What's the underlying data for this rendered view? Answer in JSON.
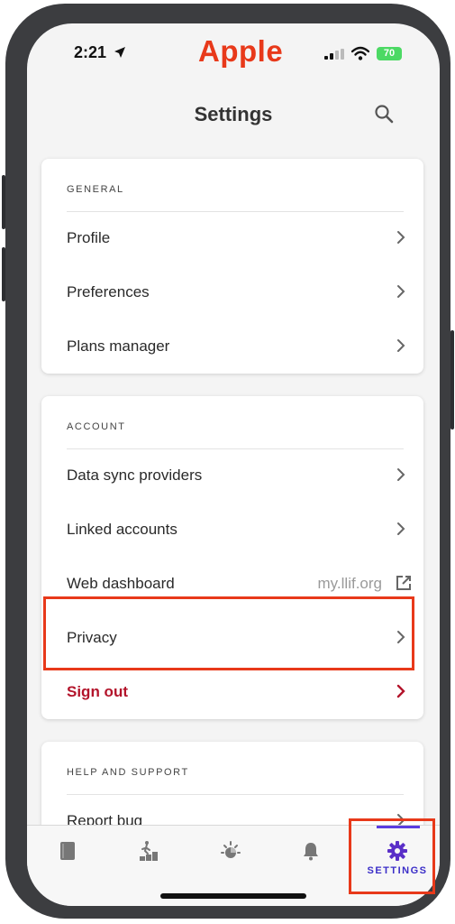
{
  "status_bar": {
    "time": "2:21",
    "brand": "Apple",
    "battery": "70"
  },
  "header": {
    "title": "Settings"
  },
  "sections": {
    "general": {
      "title": "GENERAL",
      "items": [
        {
          "label": "Profile"
        },
        {
          "label": "Preferences"
        },
        {
          "label": "Plans manager"
        }
      ]
    },
    "account": {
      "title": "ACCOUNT",
      "items": [
        {
          "label": "Data sync providers"
        },
        {
          "label": "Linked accounts"
        },
        {
          "label": "Web dashboard",
          "value": "my.llif.org"
        },
        {
          "label": "Privacy"
        },
        {
          "label": "Sign out"
        }
      ]
    },
    "help": {
      "title": "HELP AND SUPPORT",
      "items": [
        {
          "label": "Report bug"
        }
      ]
    }
  },
  "tabbar": {
    "tabs": [
      {
        "icon": "journal-icon"
      },
      {
        "icon": "progress-icon"
      },
      {
        "icon": "insights-icon"
      },
      {
        "icon": "bell-icon"
      },
      {
        "icon": "gear-icon",
        "label": "SETTINGS",
        "active": true
      }
    ]
  },
  "colors": {
    "accent": "#3b2ec8",
    "brand": "#e8391a",
    "signout": "#b3142b",
    "highlight": "#e8391a"
  }
}
